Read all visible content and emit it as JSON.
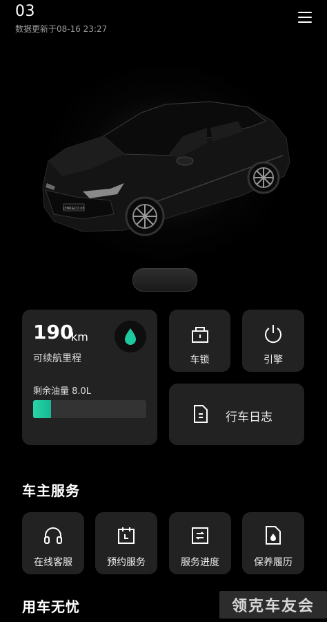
{
  "header": {
    "title": "03",
    "update_time": "数据更新于08-16 23:27"
  },
  "status": {
    "range_value": "190",
    "range_unit": "km",
    "range_label": "可续航里程",
    "fuel_label": "剩余油量 8.0L",
    "fuel_level_fraction": 0.16
  },
  "controls": {
    "lock_label": "车锁",
    "engine_label": "引擎",
    "trip_log_label": "行车日志"
  },
  "owner_services": {
    "title": "车主服务",
    "items": [
      {
        "label": "在线客服",
        "icon": "headphones-icon"
      },
      {
        "label": "预约服务",
        "icon": "calendar-icon"
      },
      {
        "label": "服务进度",
        "icon": "progress-icon"
      },
      {
        "label": "保养履历",
        "icon": "maintenance-icon"
      }
    ]
  },
  "worry_free": {
    "title": "用车无忧"
  },
  "watermark": "领克车友会",
  "car_badge": "LYNK&CO 03",
  "colors": {
    "accent": "#1fc9a0",
    "card": "#222222",
    "background": "#000000"
  }
}
